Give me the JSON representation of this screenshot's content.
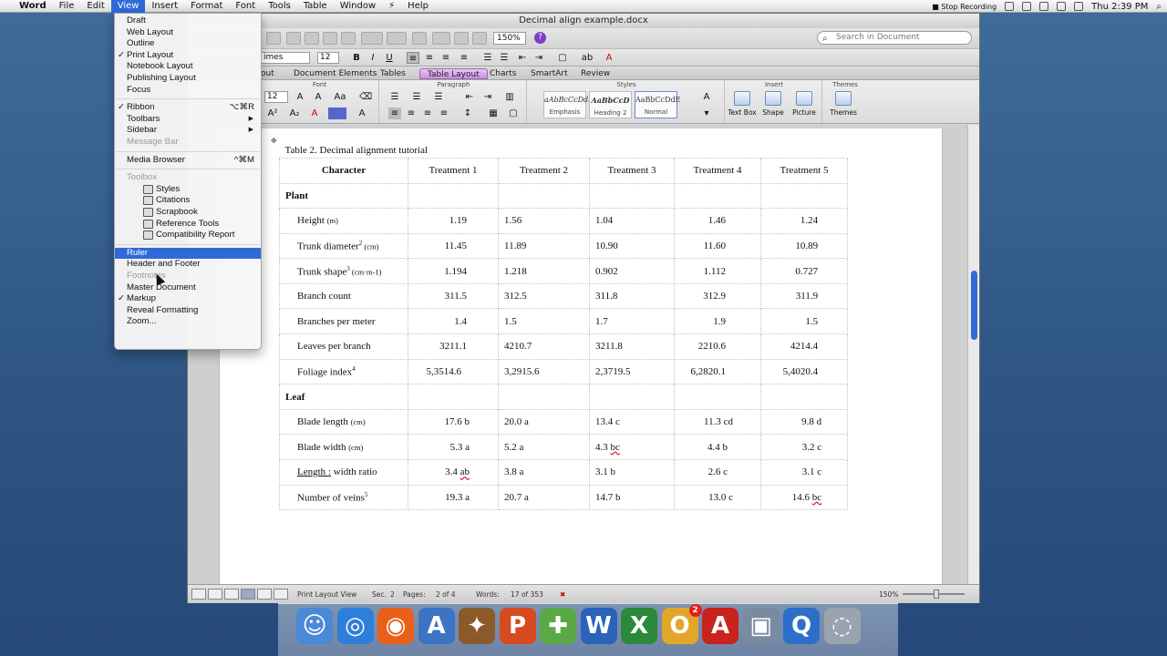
{
  "menubar": {
    "app": "Word",
    "items": [
      "File",
      "Edit",
      "View",
      "Insert",
      "Format",
      "Font",
      "Tools",
      "Table",
      "Window",
      "Help"
    ],
    "script_glyph": "⚡",
    "stop_recording": "Stop Recording",
    "clock": "Thu 2:39 PM"
  },
  "window": {
    "title": "Decimal align example.docx",
    "zoom": "150%",
    "search_placeholder": "Search in Document",
    "font_name": "imes New...",
    "font_size": "12",
    "ribbon_size": "12",
    "ribbon_tabs": [
      "out",
      "Document Elements",
      "Tables",
      "Table Layout",
      "Charts",
      "SmartArt",
      "Review"
    ],
    "ribbon_groups": {
      "font": "Font",
      "paragraph": "Paragraph",
      "styles": "Styles",
      "insert": "Insert",
      "themes": "Themes"
    },
    "styles": [
      {
        "preview": "aAbBcCcDdEe",
        "name": "Emphasis"
      },
      {
        "preview": "AaBbCcD",
        "name": "Heading 2"
      },
      {
        "preview": "AaBbCcDdE",
        "name": "Normal"
      }
    ],
    "insert_items": [
      "Text Box",
      "Shape",
      "Picture"
    ],
    "themes_label": "Themes"
  },
  "status": {
    "view": "Print Layout View",
    "sec_label": "Sec.",
    "sec": "2",
    "pages_label": "Pages:",
    "pages": "2 of 4",
    "words_label": "Words:",
    "words": "17 of 353",
    "zoom": "150%"
  },
  "view_menu": [
    {
      "label": "Draft"
    },
    {
      "label": "Web Layout"
    },
    {
      "label": "Outline"
    },
    {
      "label": "Print Layout",
      "check": "✓"
    },
    {
      "label": "Notebook Layout"
    },
    {
      "label": "Publishing Layout"
    },
    {
      "label": "Focus"
    },
    {
      "sep": true
    },
    {
      "label": "Ribbon",
      "check": "✓",
      "shortcut": "⌥⌘R"
    },
    {
      "label": "Toolbars",
      "arrow": "▶"
    },
    {
      "label": "Sidebar",
      "arrow": "▶"
    },
    {
      "label": "Message Bar",
      "disabled": true
    },
    {
      "sep": true
    },
    {
      "label": "Media Browser",
      "shortcut": "^⌘M"
    },
    {
      "sep": true
    },
    {
      "label": "Toolbox",
      "disabled": true
    },
    {
      "label": "Styles",
      "indent": true
    },
    {
      "label": "Citations",
      "indent": true
    },
    {
      "label": "Scrapbook",
      "indent": true
    },
    {
      "label": "Reference Tools",
      "indent": true
    },
    {
      "label": "Compatibility Report",
      "indent": true
    },
    {
      "sep": true
    },
    {
      "label": "Ruler",
      "highlight": true
    },
    {
      "label": "Header and Footer"
    },
    {
      "label": "Footnotes",
      "disabled": true
    },
    {
      "label": "Master Document"
    },
    {
      "label": "Markup",
      "check": "✓"
    },
    {
      "label": "Reveal Formatting"
    },
    {
      "label": "Zoom..."
    }
  ],
  "table": {
    "caption": "Table 2.  Decimal alignment tutorial",
    "headers": [
      "Character",
      "Treatment 1",
      "Treatment 2",
      "Treatment 3",
      "Treatment 4",
      "Treatment 5"
    ],
    "sections": [
      {
        "name": "Plant",
        "rows": [
          {
            "label": "Height ",
            "unit": "(m)",
            "sup": "",
            "values": [
              "1.19",
              "1.56",
              "1.04",
              "1.46",
              "1.24"
            ]
          },
          {
            "label": "Trunk diameter",
            "unit": "(cm)",
            "sup": "2",
            "values": [
              "11.45",
              "11.89",
              "10.90",
              "11.60",
              "10.89"
            ]
          },
          {
            "label": "Trunk shape",
            "unit": "(cm·m-1)",
            "sup": "3",
            "values": [
              "1.194",
              "1.218",
              "0.902",
              "1.112",
              "0.727"
            ]
          },
          {
            "label": "Branch count",
            "unit": "",
            "sup": "",
            "values": [
              "311.5",
              "312.5",
              "311.8",
              "312.9",
              "311.9"
            ]
          },
          {
            "label": "Branches per meter",
            "unit": "",
            "sup": "",
            "values": [
              "1.4",
              "1.5",
              "1.7",
              "1.9",
              "1.5"
            ]
          },
          {
            "label": "Leaves per branch",
            "unit": "",
            "sup": "",
            "values": [
              "3211.1",
              "4210.7",
              "3211.8",
              "2210.6",
              "4214.4"
            ]
          },
          {
            "label": "Foliage index",
            "unit": "",
            "sup": "4",
            "values": [
              "5,3514.6",
              "3,2915.6",
              "2,3719.5",
              "6,2820.1",
              "5,4020.4"
            ]
          }
        ]
      },
      {
        "name": "Leaf",
        "rows": [
          {
            "label": "Blade length ",
            "unit": "(cm)",
            "sup": "",
            "values": [
              "17.6 b",
              "20.0 a",
              "13.4 c",
              "11.3 cd",
              "9.8 d"
            ]
          },
          {
            "label": "Blade width ",
            "unit": "(cm)",
            "sup": "",
            "values": [
              "5.3 a",
              "5.2 a",
              "4.3 bc",
              "4.4 b",
              "3.2 c"
            ]
          },
          {
            "label": "Length : width ratio",
            "unit": "",
            "sup": "",
            "values": [
              "3.4 ab",
              "3.8 a",
              "3.1 b",
              "2.6 c",
              "3.1 c"
            ]
          },
          {
            "label": "Number of veins",
            "unit": "",
            "sup": "5",
            "values": [
              "19.3 a",
              "20.7 a",
              "14.7 b",
              "13.0 c",
              "14.6 bc"
            ]
          }
        ]
      }
    ]
  },
  "dock": {
    "items": [
      "finder-icon",
      "safari-icon",
      "firefox-icon",
      "app-store-icon",
      "eagle-icon",
      "powerpoint-icon",
      "maps-icon",
      "word-icon",
      "excel-icon",
      "outlook-icon",
      "acrobat-icon",
      "preview-icon",
      "quicktime-icon",
      "trash-icon"
    ],
    "outlook_badge": "2"
  }
}
